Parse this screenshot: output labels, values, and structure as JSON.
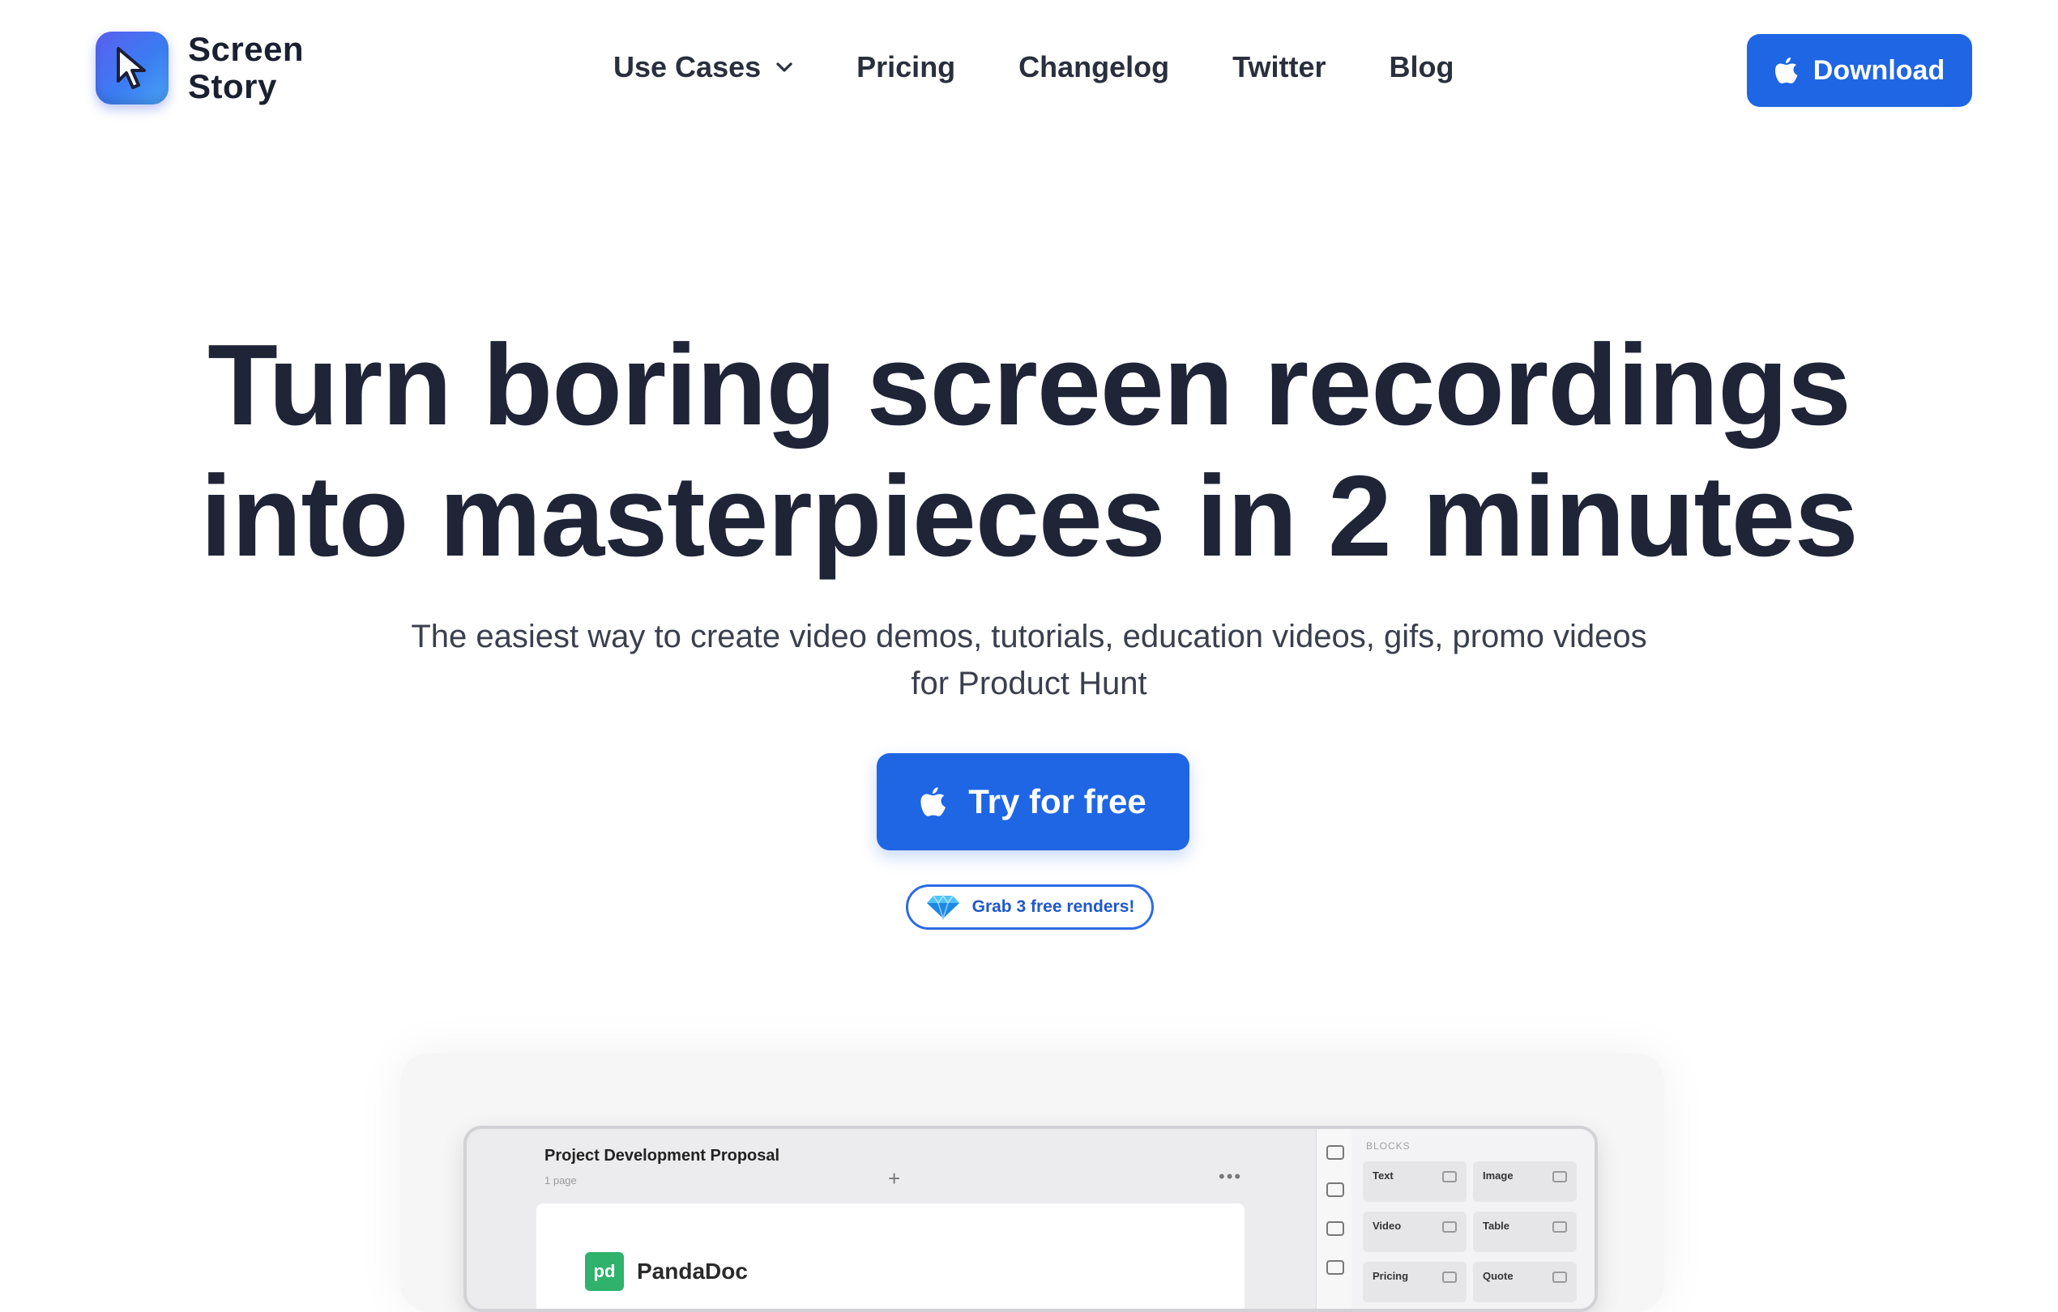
{
  "brand": {
    "line1": "Screen",
    "line2": "Story"
  },
  "nav": {
    "items": [
      {
        "label": "Use Cases",
        "has_dropdown": true
      },
      {
        "label": "Pricing"
      },
      {
        "label": "Changelog"
      },
      {
        "label": "Twitter"
      },
      {
        "label": "Blog"
      }
    ]
  },
  "header": {
    "download_label": "Download"
  },
  "hero": {
    "headline_line1": "Turn boring screen recordings",
    "headline_line2": "into masterpieces in 2 minutes",
    "subtitle_line1": "The easiest way to create video demos, tutorials, education videos, gifs, promo videos",
    "subtitle_line2": "for Product Hunt",
    "cta_label": "Try for free",
    "promo_label": "Grab 3 free renders!"
  },
  "preview": {
    "doc_title": "Project Development Proposal",
    "doc_pages": "1 page",
    "logo_mark": "pd",
    "logo_name": "PandaDoc",
    "blocks_heading": "BLOCKS",
    "blocks": [
      "Text",
      "Image",
      "Video",
      "Table",
      "Pricing",
      "Quote"
    ]
  },
  "colors": {
    "accent": "#1f66e5",
    "text": "#1f2536",
    "pandadoc_green": "#2fb26b"
  },
  "icons": {
    "brand": "cursor-pointer-icon",
    "download": "apple-icon",
    "cta": "apple-icon",
    "promo": "diamond-icon",
    "dropdown": "chevron-down-icon"
  }
}
